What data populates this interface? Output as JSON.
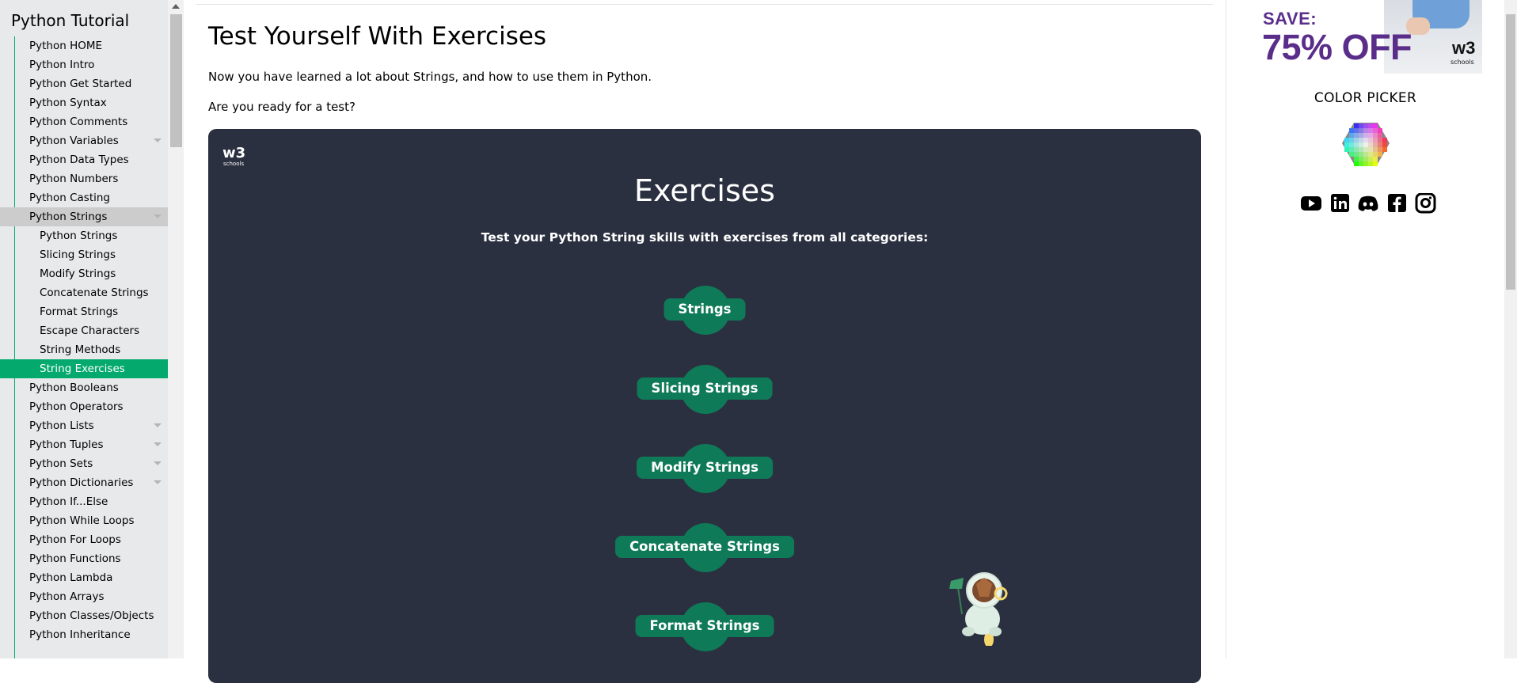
{
  "sidebar": {
    "title": "Python Tutorial",
    "items": [
      {
        "label": "Python HOME",
        "type": "item"
      },
      {
        "label": "Python Intro",
        "type": "item"
      },
      {
        "label": "Python Get Started",
        "type": "item"
      },
      {
        "label": "Python Syntax",
        "type": "item"
      },
      {
        "label": "Python Comments",
        "type": "item"
      },
      {
        "label": "Python Variables",
        "type": "item",
        "expandable": true
      },
      {
        "label": "Python Data Types",
        "type": "item"
      },
      {
        "label": "Python Numbers",
        "type": "item"
      },
      {
        "label": "Python Casting",
        "type": "item"
      },
      {
        "label": "Python Strings",
        "type": "item",
        "expandable": true,
        "open": true
      },
      {
        "label": "Python Strings",
        "type": "sub"
      },
      {
        "label": "Slicing Strings",
        "type": "sub"
      },
      {
        "label": "Modify Strings",
        "type": "sub"
      },
      {
        "label": "Concatenate Strings",
        "type": "sub"
      },
      {
        "label": "Format Strings",
        "type": "sub"
      },
      {
        "label": "Escape Characters",
        "type": "sub"
      },
      {
        "label": "String Methods",
        "type": "sub"
      },
      {
        "label": "String Exercises",
        "type": "sub",
        "active": true
      },
      {
        "label": "Python Booleans",
        "type": "item"
      },
      {
        "label": "Python Operators",
        "type": "item"
      },
      {
        "label": "Python Lists",
        "type": "item",
        "expandable": true
      },
      {
        "label": "Python Tuples",
        "type": "item",
        "expandable": true
      },
      {
        "label": "Python Sets",
        "type": "item",
        "expandable": true
      },
      {
        "label": "Python Dictionaries",
        "type": "item",
        "expandable": true
      },
      {
        "label": "Python If...Else",
        "type": "item"
      },
      {
        "label": "Python While Loops",
        "type": "item"
      },
      {
        "label": "Python For Loops",
        "type": "item"
      },
      {
        "label": "Python Functions",
        "type": "item"
      },
      {
        "label": "Python Lambda",
        "type": "item"
      },
      {
        "label": "Python Arrays",
        "type": "item"
      },
      {
        "label": "Python Classes/Objects",
        "type": "item"
      },
      {
        "label": "Python Inheritance",
        "type": "item"
      }
    ]
  },
  "main": {
    "title": "Test Yourself With Exercises",
    "intro_1": "Now you have learned a lot about Strings, and how to use them in Python.",
    "intro_2": "Are you ready for a test?",
    "exercises": {
      "logo_text": "w3",
      "logo_sub": "schools",
      "title": "Exercises",
      "subtitle": "Test your Python String skills with exercises from all categories:",
      "categories": [
        "Strings",
        "Slicing Strings",
        "Modify Strings",
        "Concatenate Strings",
        "Format Strings"
      ]
    }
  },
  "right": {
    "ad": {
      "save": "SAVE:",
      "off": "75% OFF",
      "logo": "w3",
      "logo_sub": "schools"
    },
    "color_picker_label": "COLOR PICKER",
    "social": [
      "youtube-icon",
      "linkedin-icon",
      "discord-icon",
      "facebook-icon",
      "instagram-icon"
    ]
  },
  "colors": {
    "accent": "#04aa6d",
    "exercise_bg": "#2b3040",
    "pill": "#0f7a57",
    "ad_purple": "#5a2d8a"
  }
}
